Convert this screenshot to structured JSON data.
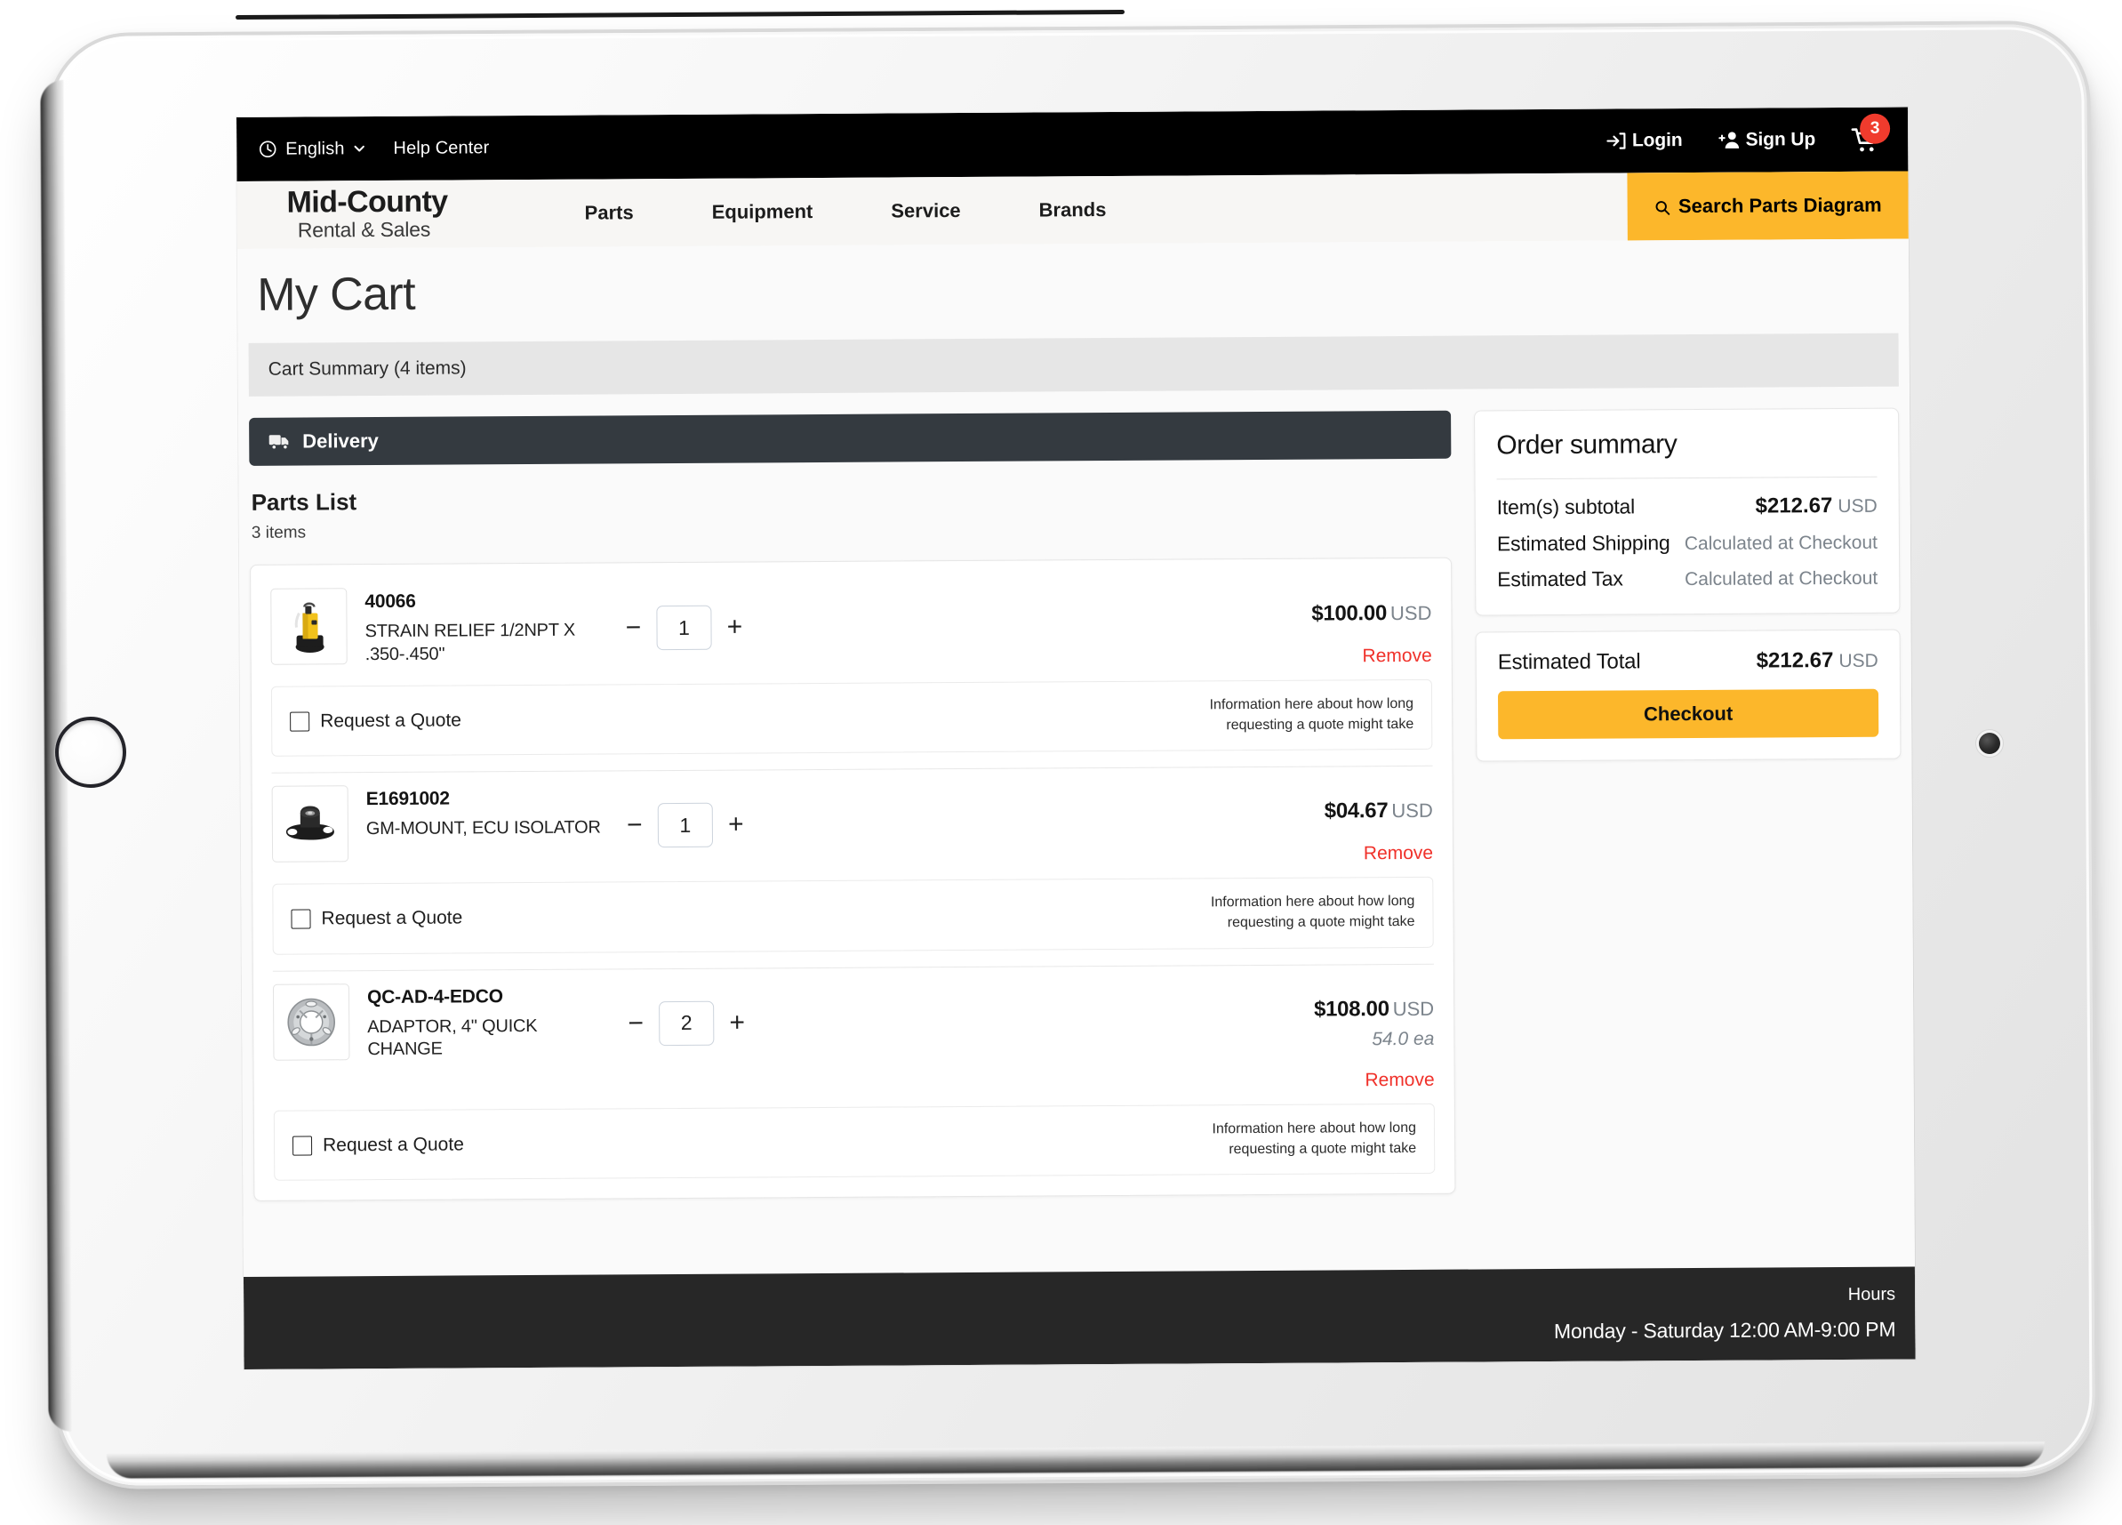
{
  "utility_bar": {
    "language": "English",
    "language_icon": "clock-icon",
    "chevron_icon": "chevron-down-icon",
    "help_center": "Help Center",
    "login": "Login",
    "login_icon": "login-arrow-icon",
    "signup": "Sign Up",
    "signup_icon": "add-person-icon",
    "cart_icon": "shopping-cart-icon",
    "cart_badge": "3"
  },
  "nav": {
    "brand_top": "Mid-County",
    "brand_sub": "Rental & Sales",
    "links": [
      {
        "label": "Parts"
      },
      {
        "label": "Equipment"
      },
      {
        "label": "Service"
      },
      {
        "label": "Brands"
      }
    ],
    "search_diagram": "Search Parts Diagram",
    "search_icon": "magnifier-icon",
    "accent_color": "#fcb72b"
  },
  "page": {
    "title": "My Cart",
    "cart_summary": "Cart Summary (4 items)",
    "delivery_tab": "Delivery",
    "delivery_icon": "truck-icon",
    "parts_list_title": "Parts List",
    "parts_list_count": "3 items"
  },
  "items": [
    {
      "sku": "40066",
      "description": "STRAIN RELIEF 1/2NPT X .350-.450\"",
      "thumb": "yellow-pump-image",
      "qty": "1",
      "minus": "−",
      "plus": "+",
      "price": "$100.00",
      "currency": "USD",
      "each": "",
      "remove": "Remove",
      "quote_label": "Request a Quote",
      "quote_note": "Information here about how long requesting a quote might take"
    },
    {
      "sku": "E1691002",
      "description": "GM-MOUNT, ECU ISOLATOR",
      "thumb": "black-mount-image",
      "qty": "1",
      "minus": "−",
      "plus": "+",
      "price": "$04.67",
      "currency": "USD",
      "each": "",
      "remove": "Remove",
      "quote_label": "Request a Quote",
      "quote_note": "Information here about how long requesting a quote might take"
    },
    {
      "sku": "QC-AD-4-EDCO",
      "description": "ADAPTOR, 4\" QUICK CHANGE",
      "thumb": "chrome-adaptor-image",
      "qty": "2",
      "minus": "−",
      "plus": "+",
      "price": "$108.00",
      "currency": "USD",
      "each": "54.0 ea",
      "remove": "Remove",
      "quote_label": "Request a Quote",
      "quote_note": "Information here about how long requesting a quote might take"
    }
  ],
  "order_summary": {
    "title": "Order summary",
    "subtotal_label": "Item(s) subtotal",
    "subtotal_value": "$212.67",
    "subtotal_currency": "USD",
    "shipping_label": "Estimated Shipping",
    "shipping_value": "Calculated at Checkout",
    "tax_label": "Estimated Tax",
    "tax_value": "Calculated at Checkout",
    "total_label": "Estimated Total",
    "total_value": "$212.67",
    "total_currency": "USD",
    "checkout": "Checkout"
  },
  "footer": {
    "hours_heading": "Hours",
    "hours_value": "Monday - Saturday 12:00 AM-9:00 PM"
  }
}
